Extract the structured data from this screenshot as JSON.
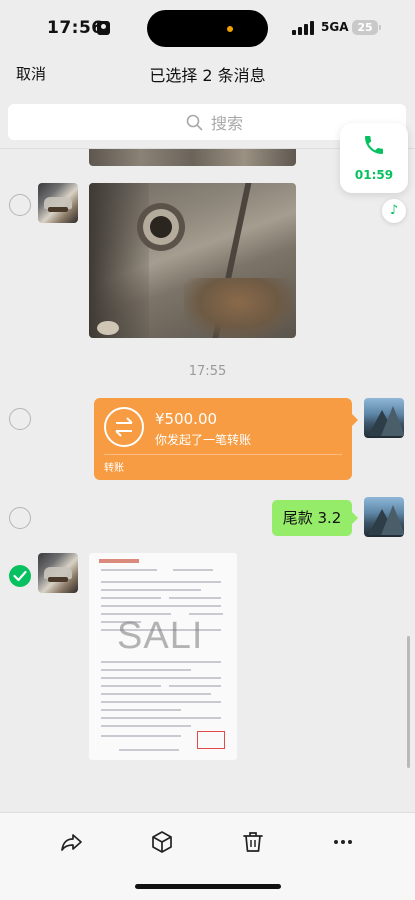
{
  "status_bar": {
    "time": "17:56",
    "network": "5GA",
    "battery": "25"
  },
  "nav": {
    "cancel_label": "取消",
    "title": "已选择 2 条消息"
  },
  "search": {
    "placeholder": "搜索"
  },
  "call_float": {
    "duration": "01:59",
    "icon": "phone-icon"
  },
  "messages": {
    "timestamp": "17:55",
    "transfer": {
      "amount": "¥500.00",
      "description": "你发起了一笔转账",
      "label": "转账",
      "icon": "transfer-icon"
    },
    "text_bubble": "尾款 3.2",
    "document_watermark": "SALI"
  },
  "selection": {
    "selected_count": 2
  },
  "toolbar": {
    "icons": [
      "forward-icon",
      "box-icon",
      "trash-icon",
      "more-icon"
    ]
  },
  "colors": {
    "wechat_green": "#07c160",
    "bubble_green": "#95ec69",
    "transfer_orange": "#f79c42",
    "background": "#ededed"
  }
}
